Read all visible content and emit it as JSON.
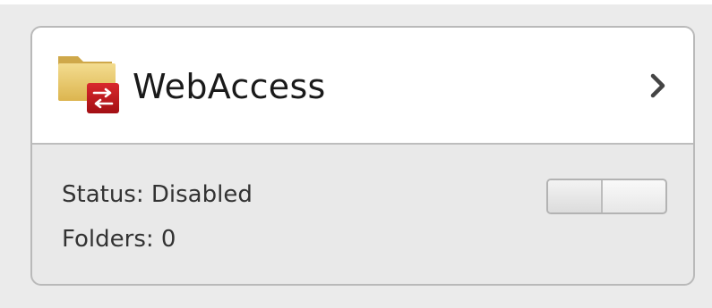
{
  "app": {
    "name": "WebAccess",
    "icon": "folder-sync-icon",
    "status_text": "Status: Disabled",
    "folders_text": "Folders: 0",
    "enabled": false
  },
  "colors": {
    "folder": "#e7c86a",
    "badge": "#c4161c"
  }
}
